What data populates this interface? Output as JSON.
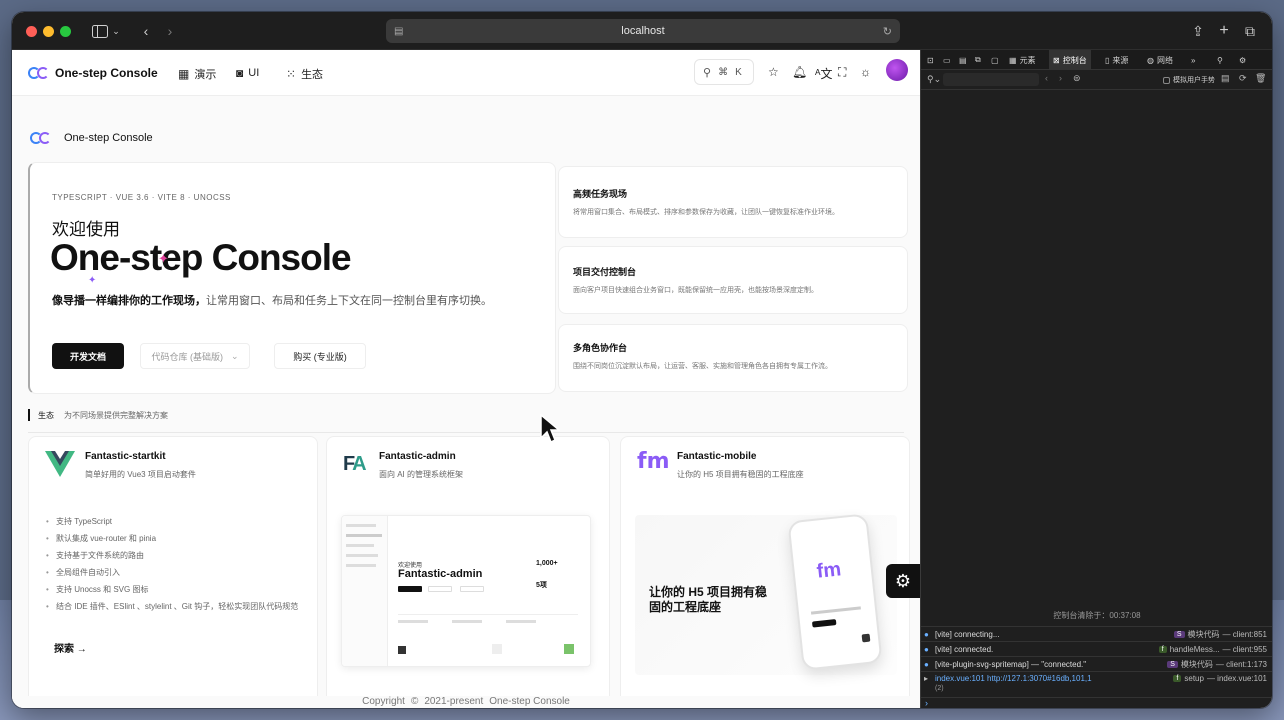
{
  "browser": {
    "address": "localhost"
  },
  "site": {
    "brand": "One-step Console",
    "nav": [
      {
        "icon": "grid-icon",
        "label": "演示"
      },
      {
        "icon": "ui-icon",
        "label": "UI"
      },
      {
        "icon": "apps-icon",
        "label": "生态"
      }
    ],
    "search_kbd": [
      "⌘",
      "K"
    ],
    "sub_brand": "One-step Console"
  },
  "hero": {
    "kicker": "TYPESCRIPT · VUE 3.6 · VITE 8 · UNOCSS",
    "welcome": "欢迎使用",
    "title": "One-step Console",
    "tagline_bold": "像导播一样编排你的工作现场，",
    "tagline_rest": "让常用窗口、布局和任务上下文在同一控制台里有序切换。",
    "buttons": {
      "docs": "开发文档",
      "repo": "代码仓库 (基础版)",
      "buy": "购买 (专业版)"
    }
  },
  "features": [
    {
      "title": "高频任务现场",
      "desc": "将常用窗口集合、布局模式、排序和参数保存为收藏，让团队一键恢复标准作业环境。"
    },
    {
      "title": "项目交付控制台",
      "desc": "面向客户项目快速组合业务窗口，既能保留统一应用壳，也能按场景深度定制。"
    },
    {
      "title": "多角色协作台",
      "desc": "围绕不同岗位沉淀默认布局，让运营、客服、实施和管理角色各自拥有专属工作流。"
    }
  ],
  "ecosystem": {
    "label": "生态",
    "desc": "为不同场景提供完整解决方案"
  },
  "products": [
    {
      "name": "Fantastic-startkit",
      "desc": "简单好用的 Vue3 项目启动套件"
    },
    {
      "name": "Fantastic-admin",
      "desc": "面向 AI 的管理系统框架"
    },
    {
      "name": "Fantastic-mobile",
      "desc": "让你的 H5 项目拥有稳固的工程底座"
    }
  ],
  "startkit_features": [
    "支持 TypeScript",
    "默认集成 vue-router 和 pinia",
    "支持基于文件系统的路由",
    "全局组件自动引入",
    "支持 Unocss 和 SVG 图标",
    "结合 IDE 插件、ESlint 、stylelint 、Git 钩子，轻松实现团队代码规范"
  ],
  "explore": "探索 →",
  "admin_preview": {
    "welcome": "欢迎使用",
    "title": "Fantastic-admin",
    "stat": "1,000+",
    "stat2": "5项"
  },
  "mobile_preview": {
    "headline": "让你的 H5 项目拥有稳固的工程底座"
  },
  "footer": {
    "copyright": "Copyright",
    "symbol": "©",
    "years": "2021-present",
    "brand": "One-step Console"
  },
  "devtools": {
    "tabs": [
      "元素",
      "控制台",
      "来源",
      "网络"
    ],
    "filter_checkbox": "模拟用户手势",
    "cleared": "控制台清除于：00:37:08",
    "logs": [
      {
        "text": "[vite] connecting...",
        "src_chip": "S",
        "src_label": "模块代码",
        "src": "— client:851"
      },
      {
        "text": "[vite] connected.",
        "src_chip": "f",
        "src_label": "handleMess...",
        "src": "— client:955"
      },
      {
        "text": "[vite-plugin-svg-spritemap] — \"connected.\"",
        "src_chip": "S",
        "src_label": "模块代码",
        "src": "— client:1:173"
      },
      {
        "text": "index.vue:101  http://127.1:3070#16db,101,1",
        "src_chip": "f",
        "src_label": "setup",
        "src": "— index.vue:101"
      }
    ],
    "log_sub": "(2)",
    "prompt": "›"
  },
  "colors": {
    "accent": "#111111",
    "devtools_bg": "#1f1f1f",
    "brand_blue": "#3b82f6",
    "brand_purple": "#8b5cf6"
  }
}
